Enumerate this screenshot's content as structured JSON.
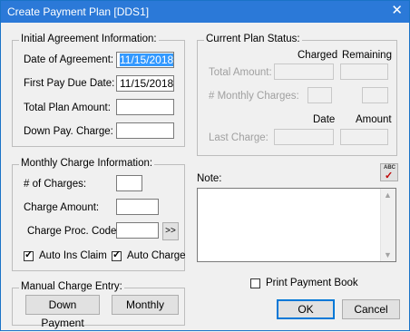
{
  "window": {
    "title": "Create Payment Plan [DDS1]",
    "close_glyph": "✕"
  },
  "initial_agreement": {
    "group_label": "Initial Agreement Information:",
    "date_of_agreement_label": "Date of Agreement:",
    "date_of_agreement_value": "11/15/2018",
    "first_pay_due_label": "First Pay Due Date:",
    "first_pay_due_value": "11/15/2018",
    "total_plan_amount_label": "Total Plan Amount:",
    "total_plan_amount_value": "",
    "down_pay_charge_label": "Down Pay. Charge:",
    "down_pay_charge_value": ""
  },
  "current_plan_status": {
    "group_label": "Current Plan Status:",
    "charged_header": "Charged",
    "remaining_header": "Remaining",
    "total_amount_label": "Total Amount:",
    "monthly_charges_label": "# Monthly Charges:",
    "date_header": "Date",
    "amount_header": "Amount",
    "last_charge_label": "Last Charge:"
  },
  "monthly_charge": {
    "group_label": "Monthly Charge Information:",
    "num_charges_label": "# of Charges:",
    "num_charges_value": "",
    "charge_amount_label": "Charge Amount:",
    "charge_amount_value": "",
    "charge_proc_code_label": "Charge Proc. Code:",
    "charge_proc_code_value": "",
    "proc_code_lookup_label": ">>",
    "auto_ins_claim_label": "Auto Ins Claim",
    "auto_ins_claim_checked": true,
    "auto_charge_label": "Auto Charge",
    "auto_charge_checked": true
  },
  "manual_charge": {
    "group_label": "Manual Charge Entry:",
    "down_payment_label": "Down Payment",
    "monthly_label": "Monthly"
  },
  "note": {
    "label": "Note:",
    "value": "",
    "spellcheck_icon": "spellcheck-icon",
    "spellcheck_text": "ABC"
  },
  "footer": {
    "print_payment_book_label": "Print Payment Book",
    "print_payment_book_checked": false,
    "ok_label": "OK",
    "cancel_label": "Cancel"
  }
}
